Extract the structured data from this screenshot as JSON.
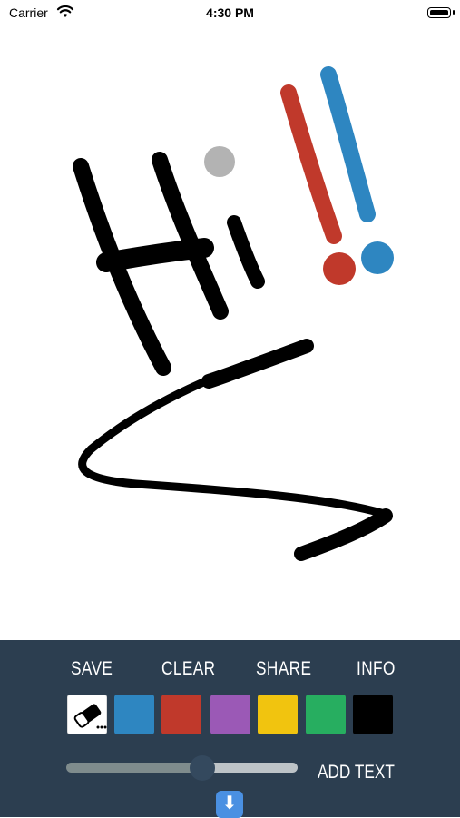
{
  "status": {
    "carrier": "Carrier",
    "time": "4:30 PM"
  },
  "toolbar": {
    "save_label": "SAVE",
    "clear_label": "CLEAR",
    "share_label": "SHARE",
    "info_label": "INFO",
    "add_text_label": "ADD TEXT",
    "colors": [
      "#2e86c1",
      "#c0392b",
      "#9b59b6",
      "#f1c40f",
      "#27ae60",
      "#000000"
    ],
    "brush_size_fraction": 0.59
  },
  "drawing": {
    "stroke_colors": [
      "#000000",
      "#c0392b",
      "#2e86c1",
      "#b3b3b3"
    ]
  }
}
